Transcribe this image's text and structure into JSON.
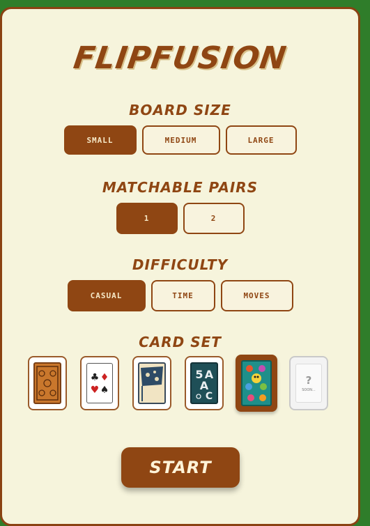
{
  "app": {
    "title": "FLIPFUSION"
  },
  "board_size": {
    "heading": "BOARD SIZE",
    "options": [
      "SMALL",
      "MEDIUM",
      "LARGE"
    ],
    "selected": "SMALL"
  },
  "pairs": {
    "heading": "MATCHABLE PAIRS",
    "options": [
      "1",
      "2"
    ],
    "selected": "1"
  },
  "difficulty": {
    "heading": "DIFFICULTY",
    "options": [
      "CASUAL",
      "TIME",
      "MOVES"
    ],
    "selected": "CASUAL"
  },
  "card_set": {
    "heading": "CARD SET",
    "items": [
      {
        "name": "wooden-pattern",
        "icon": "ornate-card-icon"
      },
      {
        "name": "playing-cards",
        "icon": "card-suits-icon"
      },
      {
        "name": "world-map",
        "icon": "map-flag-icon"
      },
      {
        "name": "alphabet",
        "icon": "letters-icon"
      },
      {
        "name": "monsters",
        "icon": "monsters-icon",
        "selected": true
      },
      {
        "name": "coming-soon",
        "icon": "question-mark-icon",
        "mark": "?",
        "label": "SOON..."
      }
    ]
  },
  "start_label": "START",
  "colors": {
    "accent": "#8f4613",
    "panel": "#f6f4dc",
    "background": "#2f7d2a"
  }
}
